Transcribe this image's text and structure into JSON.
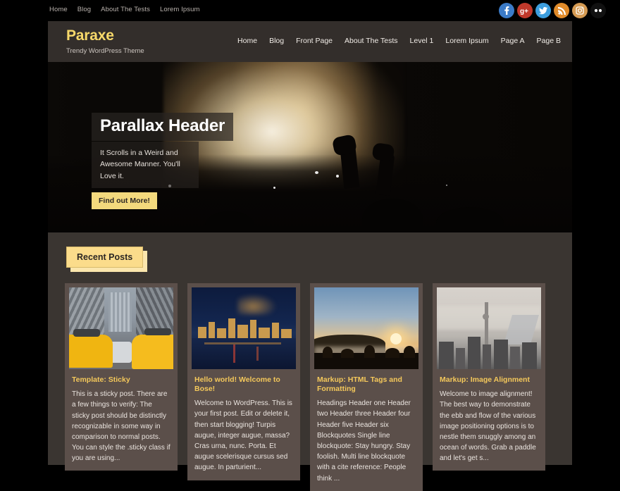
{
  "topbar": {
    "nav": [
      {
        "label": "Home"
      },
      {
        "label": "Blog"
      },
      {
        "label": "About The Tests"
      },
      {
        "label": "Lorem Ipsum"
      }
    ],
    "socials": [
      {
        "name": "facebook-icon",
        "glyph": "f"
      },
      {
        "name": "google-plus-icon",
        "glyph": "g+"
      },
      {
        "name": "twitter-icon",
        "glyph": "t"
      },
      {
        "name": "rss-icon",
        "glyph": "rss"
      },
      {
        "name": "instagram-icon",
        "glyph": "ig"
      },
      {
        "name": "more-icon",
        "glyph": "••"
      }
    ]
  },
  "header": {
    "site_title": "Paraxe",
    "tagline": "Trendy WordPress Theme",
    "nav": [
      {
        "label": "Home"
      },
      {
        "label": "Blog"
      },
      {
        "label": "Front Page"
      },
      {
        "label": "About The Tests"
      },
      {
        "label": "Level 1"
      },
      {
        "label": "Lorem Ipsum"
      },
      {
        "label": "Page A"
      },
      {
        "label": "Page B"
      }
    ]
  },
  "hero": {
    "title": "Parallax Header",
    "subtitle": "It Scrolls in a Weird and Awesome Manner. You'll Love it.",
    "button_label": "Find out More!"
  },
  "section": {
    "recent_posts_label": "Recent Posts"
  },
  "posts": [
    {
      "title": "Template: Sticky",
      "excerpt": "This is a sticky post. There are a few things to verify: The sticky post should be distinctly recognizable in some way in comparison to normal posts. You can style the .sticky class if you are using...",
      "image": "new-york-street-with-yellow-taxis"
    },
    {
      "title": "Hello world! Welcome to Bose!",
      "excerpt": "Welcome to WordPress. This is your first post. Edit or delete it, then start blogging! Turpis augue, integer augue, massa? Cras urna, nunc. Porta. Et augue scelerisque cursus sed augue. In parturient...",
      "image": "night-city-skyline-over-water"
    },
    {
      "title": "Markup: HTML Tags and Formatting",
      "excerpt": "Headings Header one Header two Header three Header four Header five Header six Blockquotes Single line blockquote: Stay hungry. Stay foolish. Multi line blockquote with a cite reference: People think ...",
      "image": "mountain-sunrise-above-fog"
    },
    {
      "title": "Markup: Image Alignment",
      "excerpt": "Welcome to image alignment! The best way to demonstrate the ebb and flow of the various image positioning options is to nestle them snuggly among an ocean of words. Grab a paddle and let's get s...",
      "image": "hazy-aerial-view-of-city"
    }
  ],
  "colors": {
    "accent_yellow": "#f7d96a",
    "title_yellow": "#f4c85b",
    "badge_yellow": "#fbdc8b",
    "page_bg": "#3a3531",
    "header_bg": "#332e2b",
    "card_bg": "#5b4f4a",
    "outer_bg": "#000000"
  }
}
